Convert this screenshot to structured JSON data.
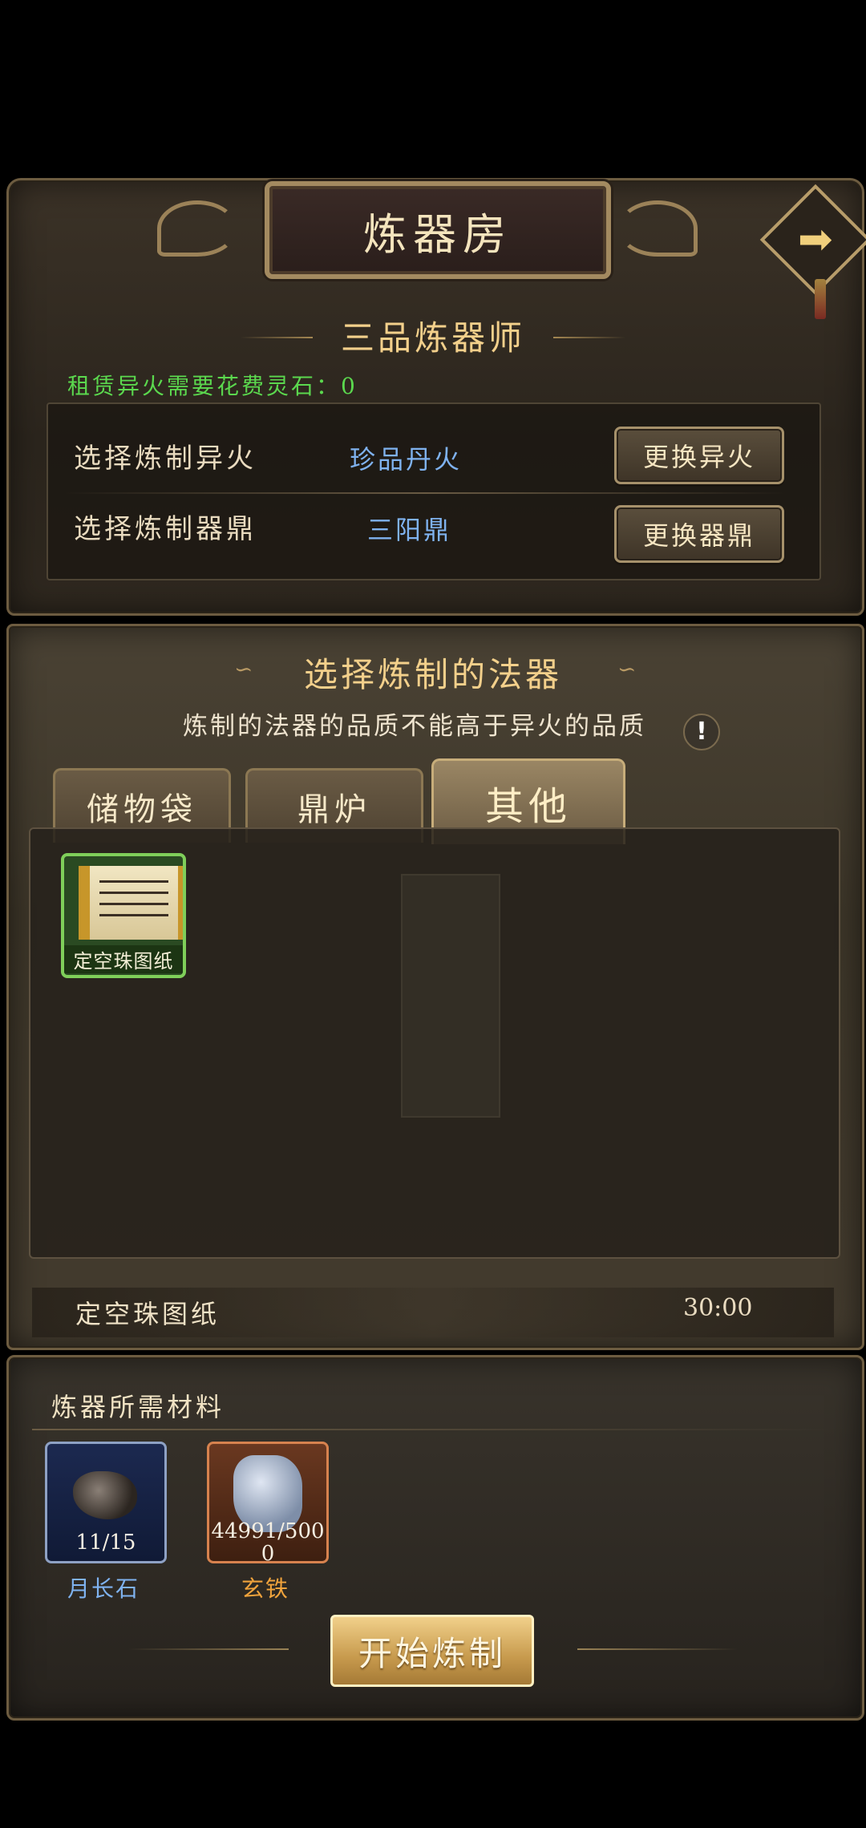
{
  "header": {
    "title": "炼器房",
    "next_icon": "➡"
  },
  "rank": {
    "title": "三品炼器师"
  },
  "rent": {
    "text": "租赁异火需要花费灵石：0"
  },
  "fire": {
    "label": "选择炼制异火",
    "value": "珍品丹火",
    "button": "更换异火"
  },
  "cauldron": {
    "label": "选择炼制器鼎",
    "value": "三阳鼎",
    "button": "更换器鼎"
  },
  "section": {
    "title": "选择炼制的法器",
    "hint": "炼制的法器的品质不能高于异火的品质",
    "hint_icon": "!"
  },
  "tabs": [
    {
      "label": "储物袋"
    },
    {
      "label": "鼎炉"
    },
    {
      "label": "其他"
    }
  ],
  "items": [
    {
      "name": "定空珠图纸",
      "icon": "scroll-icon"
    }
  ],
  "selected": {
    "name": "定空珠图纸",
    "time": "30:00"
  },
  "materials": {
    "title": "炼器所需材料",
    "list": [
      {
        "name": "月长石",
        "count": "11/15",
        "name_color": "#7fb2ef"
      },
      {
        "name": "玄铁",
        "count_line1": "44991/500",
        "count_line2": "0",
        "name_color": "#f0a33c"
      }
    ]
  },
  "start_button": "开始炼制",
  "colors": {
    "accent_gold": "#f3d08b",
    "rent_green": "#5bd84e",
    "value_blue": "#7fb2ef"
  }
}
